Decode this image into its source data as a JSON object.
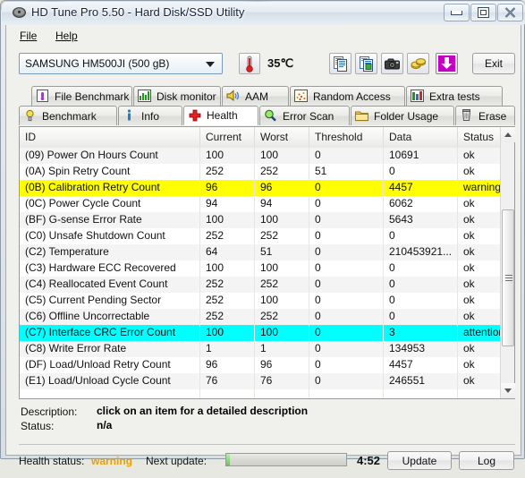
{
  "window": {
    "title": "HD Tune Pro 5.50 - Hard Disk/SSD Utility",
    "icon": "disk-icon",
    "minimize": "minimize-icon",
    "maximize": "maximize-icon",
    "close": "close-icon"
  },
  "menu": {
    "items": [
      {
        "label": "File",
        "name": "menu-file"
      },
      {
        "label": "Help",
        "name": "menu-help"
      }
    ]
  },
  "toolbar": {
    "drive": {
      "selected": "SAMSUNG HM500JI (500 gB)",
      "arrow": "chevron-down-icon"
    },
    "temperature": {
      "icon": "thermometer-icon",
      "value": "35℃"
    },
    "buttons": [
      {
        "name": "copy-to-clipboard-button",
        "icon": "copy-documents-icon"
      },
      {
        "name": "copy-to-file-button",
        "icon": "copy-file-icon"
      },
      {
        "name": "screenshot-button",
        "icon": "camera-icon"
      },
      {
        "name": "settings-button",
        "icon": "gold-coins-icon"
      },
      {
        "name": "download-button",
        "icon": "download-arrow-icon"
      }
    ],
    "exit_label": "Exit"
  },
  "tabs": {
    "row1": [
      {
        "label": "File Benchmark",
        "icon": "file-benchmark-icon",
        "active": false
      },
      {
        "label": "Disk monitor",
        "icon": "bar-chart-icon",
        "active": false
      },
      {
        "label": "AAM",
        "icon": "speaker-icon",
        "active": false
      },
      {
        "label": "Random Access",
        "icon": "scatter-icon",
        "active": false
      },
      {
        "label": "Extra tests",
        "icon": "extra-chart-icon",
        "active": false
      }
    ],
    "row2": [
      {
        "label": "Benchmark",
        "icon": "bulb-icon",
        "active": false
      },
      {
        "label": "Info",
        "icon": "info-icon",
        "active": false
      },
      {
        "label": "Health",
        "icon": "red-cross-icon",
        "active": true
      },
      {
        "label": "Error Scan",
        "icon": "magnifier-icon",
        "active": false
      },
      {
        "label": "Folder Usage",
        "icon": "folder-icon",
        "active": false
      },
      {
        "label": "Erase",
        "icon": "trash-icon",
        "active": false
      }
    ]
  },
  "table": {
    "columns": [
      "ID",
      "Current",
      "Worst",
      "Threshold",
      "Data",
      "Status"
    ],
    "rows": [
      {
        "id": "(09) Power On Hours Count",
        "current": "100",
        "worst": "100",
        "threshold": "0",
        "data": "10691",
        "status": "ok",
        "highlight": "none"
      },
      {
        "id": "(0A) Spin Retry Count",
        "current": "252",
        "worst": "252",
        "threshold": "51",
        "data": "0",
        "status": "ok",
        "highlight": "none"
      },
      {
        "id": "(0B) Calibration Retry Count",
        "current": "96",
        "worst": "96",
        "threshold": "0",
        "data": "4457",
        "status": "warning",
        "highlight": "warning"
      },
      {
        "id": "(0C) Power Cycle Count",
        "current": "94",
        "worst": "94",
        "threshold": "0",
        "data": "6062",
        "status": "ok",
        "highlight": "none"
      },
      {
        "id": "(BF) G-sense Error Rate",
        "current": "100",
        "worst": "100",
        "threshold": "0",
        "data": "5643",
        "status": "ok",
        "highlight": "none"
      },
      {
        "id": "(C0) Unsafe Shutdown Count",
        "current": "252",
        "worst": "252",
        "threshold": "0",
        "data": "0",
        "status": "ok",
        "highlight": "none"
      },
      {
        "id": "(C2) Temperature",
        "current": "64",
        "worst": "51",
        "threshold": "0",
        "data": "210453921...",
        "status": "ok",
        "highlight": "none"
      },
      {
        "id": "(C3) Hardware ECC Recovered",
        "current": "100",
        "worst": "100",
        "threshold": "0",
        "data": "0",
        "status": "ok",
        "highlight": "none"
      },
      {
        "id": "(C4) Reallocated Event Count",
        "current": "252",
        "worst": "252",
        "threshold": "0",
        "data": "0",
        "status": "ok",
        "highlight": "none"
      },
      {
        "id": "(C5) Current Pending Sector",
        "current": "252",
        "worst": "100",
        "threshold": "0",
        "data": "0",
        "status": "ok",
        "highlight": "none"
      },
      {
        "id": "(C6) Offline Uncorrectable",
        "current": "252",
        "worst": "252",
        "threshold": "0",
        "data": "0",
        "status": "ok",
        "highlight": "none"
      },
      {
        "id": "(C7) Interface CRC Error Count",
        "current": "100",
        "worst": "100",
        "threshold": "0",
        "data": "3",
        "status": "attention",
        "highlight": "attention"
      },
      {
        "id": "(C8) Write Error Rate",
        "current": "1",
        "worst": "1",
        "threshold": "0",
        "data": "134953",
        "status": "ok",
        "highlight": "none"
      },
      {
        "id": "(DF) Load/Unload Retry Count",
        "current": "96",
        "worst": "96",
        "threshold": "0",
        "data": "4457",
        "status": "ok",
        "highlight": "none"
      },
      {
        "id": "(E1) Load/Unload Cycle Count",
        "current": "76",
        "worst": "76",
        "threshold": "0",
        "data": "246551",
        "status": "ok",
        "highlight": "none"
      }
    ],
    "scrollbar": {
      "up": "scroll-up-icon",
      "down": "scroll-down-icon"
    }
  },
  "details": {
    "description_label": "Description:",
    "description_value": "click on an item for a detailed description",
    "status_label": "Status:",
    "status_value": "n/a"
  },
  "statusbar": {
    "health_label": "Health status:",
    "health_value": "warning",
    "health_color": "#e8a000",
    "next_update_label": "Next update:",
    "next_update_time": "4:52",
    "progress_percent": 3,
    "update_label": "Update",
    "log_label": "Log"
  },
  "colors": {
    "warning_row": "#ffff00",
    "attention_row": "#00ffff",
    "accent": "#e8a000"
  }
}
